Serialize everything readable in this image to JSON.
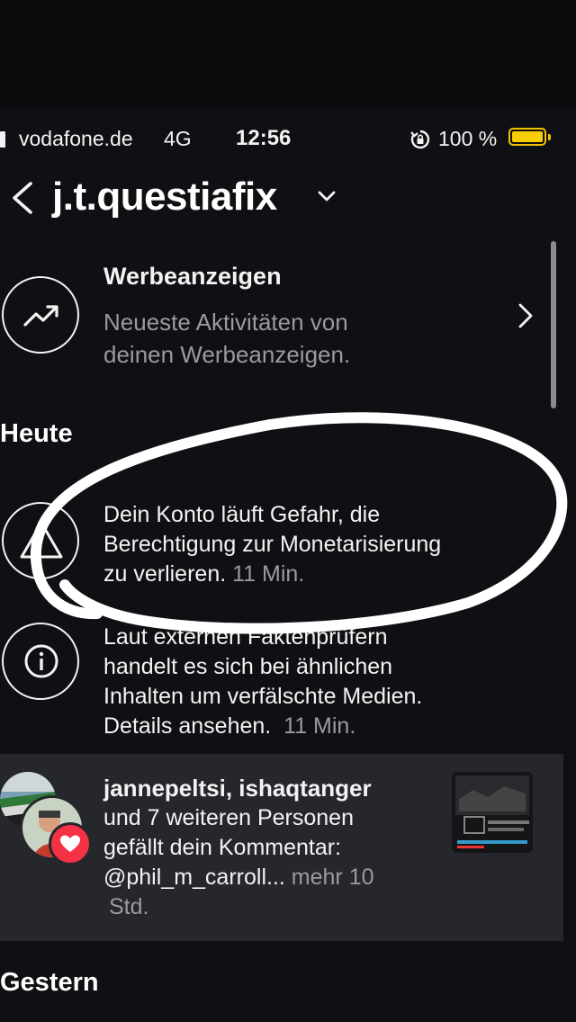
{
  "status_bar": {
    "carrier": "vodafone.de",
    "network": "4G",
    "time": "12:56",
    "battery_percent": "100 %",
    "battery_level": 1.0,
    "icons": [
      "signal-icon",
      "orientation-lock-icon",
      "battery-icon"
    ]
  },
  "header": {
    "username": "j.t.questiafix",
    "icons": [
      "back-arrow-icon",
      "chevron-down-icon"
    ]
  },
  "ads_row": {
    "title": "Werbeanzeigen",
    "subtitle_line1": "Neueste Aktivitäten von",
    "subtitle_line2": "deinen Werbeanzeigen.",
    "icon": "trending-up-icon"
  },
  "sections": {
    "today": "Heute",
    "yesterday": "Gestern"
  },
  "notifications": [
    {
      "icon": "warning-triangle-icon",
      "line1": "Dein Konto läuft Gefahr, die",
      "line2": "Berechtigung zur Monetarisierung",
      "line3": "zu verlieren.",
      "time": "11 Min."
    },
    {
      "icon": "info-icon",
      "line1": "Laut externen Faktenprüfern",
      "line2": "handelt es sich bei ähnlichen",
      "line3": "Inhalten um verfälschte Medien.",
      "line4": "Details ansehen.",
      "time": "11 Min."
    },
    {
      "icon": "heart-icon",
      "users": "jannepeltsi, ishaqtanger",
      "line2": "und 7 weiteren Personen",
      "line3": "gefällt dein Kommentar:",
      "line4": "@phil_m_carroll...",
      "time": "mehr 10",
      "time_cont": "Std.",
      "accent_color": "#f53145",
      "highlight_bg": "#25272c"
    }
  ],
  "colors": {
    "background": "#0f1013",
    "muted_text": "#9a9a9f",
    "battery": "#f7cf00",
    "annotation": "#ffffff"
  }
}
